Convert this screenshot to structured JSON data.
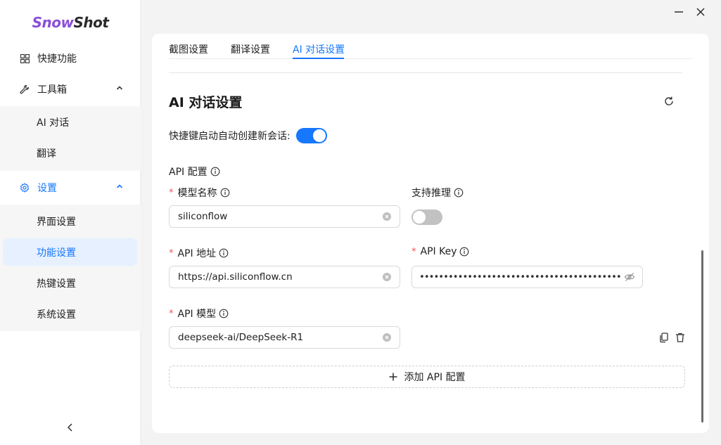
{
  "app": {
    "logo_part1": "Snow",
    "logo_part2": "Shot"
  },
  "sidebar": {
    "items": [
      {
        "label": "快捷功能",
        "icon": "grid-icon"
      },
      {
        "label": "工具箱",
        "icon": "wrench-icon"
      },
      {
        "label": "设置",
        "icon": "gear-icon"
      }
    ],
    "toolbox_sub": [
      "AI 对话",
      "翻译"
    ],
    "settings_sub": [
      "界面设置",
      "功能设置",
      "热键设置",
      "系统设置"
    ],
    "selected": "功能设置"
  },
  "tabs": [
    {
      "label": "截图设置"
    },
    {
      "label": "翻译设置"
    },
    {
      "label": "AI 对话设置"
    }
  ],
  "active_tab": "AI 对话设置",
  "section": {
    "title": "AI 对话设置",
    "auto_new_session_label": "快捷键启动自动创建新会话:",
    "auto_new_session_on": true,
    "api_config_label": "API 配置"
  },
  "form": {
    "model_name_label": "模型名称",
    "model_name_value": "siliconflow",
    "reasoning_label": "支持推理",
    "reasoning_on": false,
    "api_url_label": "API 地址",
    "api_url_value": "https://api.siliconflow.cn",
    "api_key_label": "API Key",
    "api_key_masked": "•••••••••••••••••••••••••••••••••••••••••••••••••••••••••••••••",
    "api_model_label": "API 模型",
    "api_model_value": "deepseek-ai/DeepSeek-R1"
  },
  "add_button_label": "添加 API 配置",
  "colors": {
    "accent": "#1677ff",
    "logo_purple": "#8a4fd8",
    "required": "#ff4d4f"
  }
}
